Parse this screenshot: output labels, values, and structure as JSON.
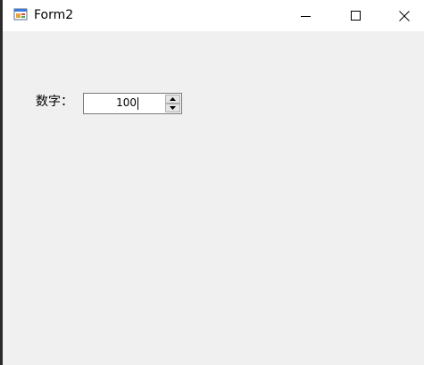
{
  "window": {
    "title": "Form2"
  },
  "titlebar": {
    "minimize_icon": "minimize-icon",
    "maximize_icon": "maximize-icon",
    "close_icon": "close-icon",
    "app_icon": "form-app-icon"
  },
  "form": {
    "label": "数字：",
    "numeric_value": "100",
    "spin_up_icon": "arrow-up-icon",
    "spin_down_icon": "arrow-down-icon"
  }
}
